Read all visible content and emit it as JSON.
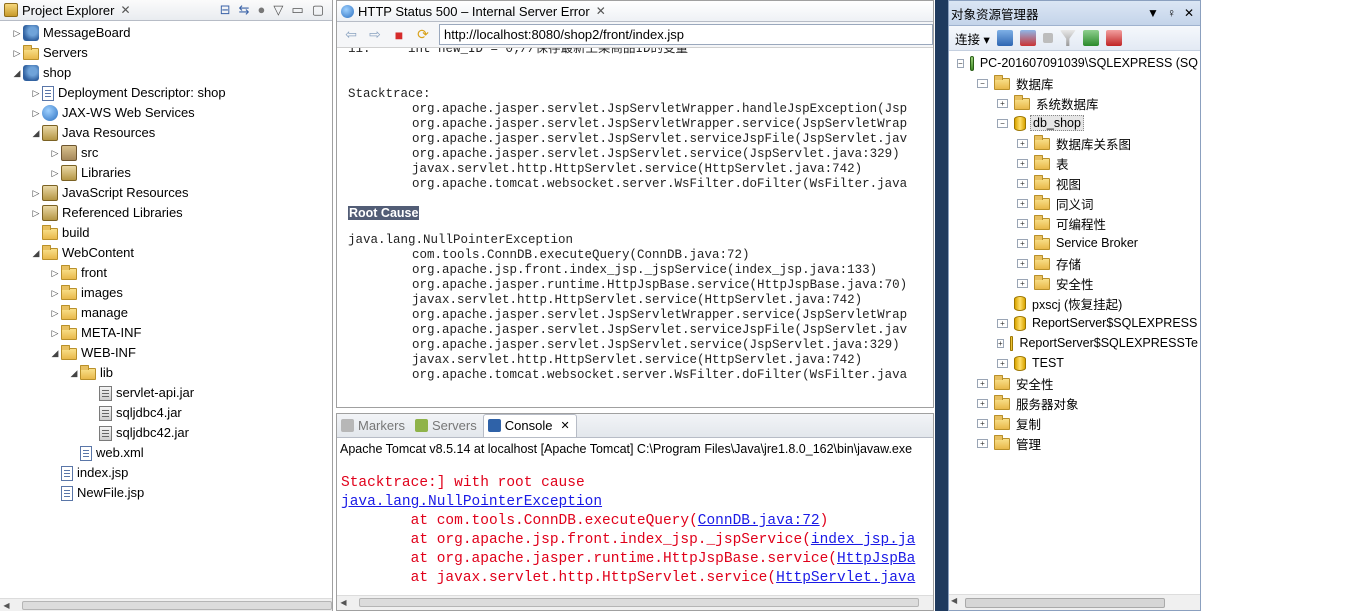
{
  "project_explorer": {
    "title": "Project Explorer",
    "tree": [
      {
        "label": "MessageBoard",
        "depth": 0,
        "twisty": "▷",
        "icon": "project-icon"
      },
      {
        "label": "Servers",
        "depth": 0,
        "twisty": "▷",
        "icon": "folder-icon"
      },
      {
        "label": "shop",
        "depth": 0,
        "twisty": "◢",
        "icon": "project-icon"
      },
      {
        "label": "Deployment Descriptor: shop",
        "depth": 1,
        "twisty": "▷",
        "icon": "descriptor-icon"
      },
      {
        "label": "JAX-WS Web Services",
        "depth": 1,
        "twisty": "▷",
        "icon": "webservice-icon"
      },
      {
        "label": "Java Resources",
        "depth": 1,
        "twisty": "◢",
        "icon": "java-resources-icon"
      },
      {
        "label": "src",
        "depth": 2,
        "twisty": "▷",
        "icon": "package-folder-icon"
      },
      {
        "label": "Libraries",
        "depth": 2,
        "twisty": "▷",
        "icon": "library-icon"
      },
      {
        "label": "JavaScript Resources",
        "depth": 1,
        "twisty": "▷",
        "icon": "js-resources-icon"
      },
      {
        "label": "Referenced Libraries",
        "depth": 1,
        "twisty": "▷",
        "icon": "library-icon"
      },
      {
        "label": "build",
        "depth": 1,
        "twisty": "",
        "icon": "folder-icon"
      },
      {
        "label": "WebContent",
        "depth": 1,
        "twisty": "◢",
        "icon": "folder-icon"
      },
      {
        "label": "front",
        "depth": 2,
        "twisty": "▷",
        "icon": "folder-icon"
      },
      {
        "label": "images",
        "depth": 2,
        "twisty": "▷",
        "icon": "folder-icon"
      },
      {
        "label": "manage",
        "depth": 2,
        "twisty": "▷",
        "icon": "folder-icon"
      },
      {
        "label": "META-INF",
        "depth": 2,
        "twisty": "▷",
        "icon": "folder-icon"
      },
      {
        "label": "WEB-INF",
        "depth": 2,
        "twisty": "◢",
        "icon": "folder-icon"
      },
      {
        "label": "lib",
        "depth": 3,
        "twisty": "◢",
        "icon": "folder-icon"
      },
      {
        "label": "servlet-api.jar",
        "depth": 4,
        "twisty": "",
        "icon": "jar-icon"
      },
      {
        "label": "sqljdbc4.jar",
        "depth": 4,
        "twisty": "",
        "icon": "jar-icon"
      },
      {
        "label": "sqljdbc42.jar",
        "depth": 4,
        "twisty": "",
        "icon": "jar-icon"
      },
      {
        "label": "web.xml",
        "depth": 3,
        "twisty": "",
        "icon": "xml-file-icon"
      },
      {
        "label": "index.jsp",
        "depth": 2,
        "twisty": "",
        "icon": "jsp-file-icon"
      },
      {
        "label": "NewFile.jsp",
        "depth": 2,
        "twisty": "",
        "icon": "jsp-file-icon"
      }
    ]
  },
  "browser": {
    "tab_title": "HTTP Status 500 – Internal Server Error",
    "url": "http://localhost:8080/shop2/front/index.jsp",
    "top_line": "11:     int new_ID = 0;//保存最新上架商品ID的变量",
    "stacktrace_heading": "Stacktrace:",
    "stacktrace": [
      "org.apache.jasper.servlet.JspServletWrapper.handleJspException(Jsp",
      "org.apache.jasper.servlet.JspServletWrapper.service(JspServletWrap",
      "org.apache.jasper.servlet.JspServlet.serviceJspFile(JspServlet.jav",
      "org.apache.jasper.servlet.JspServlet.service(JspServlet.java:329)",
      "javax.servlet.http.HttpServlet.service(HttpServlet.java:742)",
      "org.apache.tomcat.websocket.server.WsFilter.doFilter(WsFilter.java"
    ],
    "root_cause_heading": "Root Cause",
    "exception": "java.lang.NullPointerException",
    "root_cause": [
      "com.tools.ConnDB.executeQuery(ConnDB.java:72)",
      "org.apache.jsp.front.index_jsp._jspService(index_jsp.java:133)",
      "org.apache.jasper.runtime.HttpJspBase.service(HttpJspBase.java:70)",
      "javax.servlet.http.HttpServlet.service(HttpServlet.java:742)",
      "org.apache.jasper.servlet.JspServletWrapper.service(JspServletWrap",
      "org.apache.jasper.servlet.JspServlet.serviceJspFile(JspServlet.jav",
      "org.apache.jasper.servlet.JspServlet.service(JspServlet.java:329)",
      "javax.servlet.http.HttpServlet.service(HttpServlet.java:742)",
      "org.apache.tomcat.websocket.server.WsFilter.doFilter(WsFilter.java"
    ]
  },
  "console": {
    "tabs": [
      {
        "label": "Markers",
        "active": false
      },
      {
        "label": "Servers",
        "active": false
      },
      {
        "label": "Console",
        "active": true
      }
    ],
    "description": "Apache Tomcat v8.5.14 at localhost [Apache Tomcat] C:\\Program Files\\Java\\jre1.8.0_162\\bin\\javaw.exe",
    "line1": "Stacktrace:] with root cause",
    "line2_link": "java.lang.NullPointerException",
    "frames": [
      {
        "prefix": "\tat com.tools.ConnDB.executeQuery(",
        "link": "ConnDB.java:72",
        "suffix": ")"
      },
      {
        "prefix": "\tat org.apache.jsp.front.index_jsp._jspService(",
        "link": "index_jsp.ja",
        "suffix": ""
      },
      {
        "prefix": "\tat org.apache.jasper.runtime.HttpJspBase.service(",
        "link": "HttpJspBa",
        "suffix": ""
      },
      {
        "prefix": "\tat javax.servlet.http.HttpServlet.service(",
        "link": "HttpServlet.java",
        "suffix": ""
      }
    ]
  },
  "object_explorer": {
    "title": "对象资源管理器",
    "connect_label": "连接",
    "tree": [
      {
        "label": "PC-201607091039\\SQLEXPRESS (SQ",
        "depth": 0,
        "pm": "−",
        "icon": "server-icon",
        "selected": false
      },
      {
        "label": "数据库",
        "depth": 1,
        "pm": "−",
        "icon": "folder-icon",
        "selected": false
      },
      {
        "label": "系统数据库",
        "depth": 2,
        "pm": "+",
        "icon": "folder-icon",
        "selected": false
      },
      {
        "label": "db_shop",
        "depth": 2,
        "pm": "−",
        "icon": "database-icon",
        "selected": true
      },
      {
        "label": "数据库关系图",
        "depth": 3,
        "pm": "+",
        "icon": "folder-icon",
        "selected": false
      },
      {
        "label": "表",
        "depth": 3,
        "pm": "+",
        "icon": "folder-icon",
        "selected": false
      },
      {
        "label": "视图",
        "depth": 3,
        "pm": "+",
        "icon": "folder-icon",
        "selected": false
      },
      {
        "label": "同义词",
        "depth": 3,
        "pm": "+",
        "icon": "folder-icon",
        "selected": false
      },
      {
        "label": "可编程性",
        "depth": 3,
        "pm": "+",
        "icon": "folder-icon",
        "selected": false
      },
      {
        "label": "Service Broker",
        "depth": 3,
        "pm": "+",
        "icon": "folder-icon",
        "selected": false
      },
      {
        "label": "存储",
        "depth": 3,
        "pm": "+",
        "icon": "folder-icon",
        "selected": false
      },
      {
        "label": "安全性",
        "depth": 3,
        "pm": "+",
        "icon": "folder-icon",
        "selected": false
      },
      {
        "label": "pxscj (恢复挂起)",
        "depth": 2,
        "pm": "",
        "icon": "database-icon",
        "selected": false
      },
      {
        "label": "ReportServer$SQLEXPRESS",
        "depth": 2,
        "pm": "+",
        "icon": "database-icon",
        "selected": false
      },
      {
        "label": "ReportServer$SQLEXPRESSTe",
        "depth": 2,
        "pm": "+",
        "icon": "database-icon",
        "selected": false
      },
      {
        "label": "TEST",
        "depth": 2,
        "pm": "+",
        "icon": "database-icon",
        "selected": false
      },
      {
        "label": "安全性",
        "depth": 1,
        "pm": "+",
        "icon": "folder-icon",
        "selected": false
      },
      {
        "label": "服务器对象",
        "depth": 1,
        "pm": "+",
        "icon": "folder-icon",
        "selected": false
      },
      {
        "label": "复制",
        "depth": 1,
        "pm": "+",
        "icon": "folder-icon",
        "selected": false
      },
      {
        "label": "管理",
        "depth": 1,
        "pm": "+",
        "icon": "folder-icon",
        "selected": false
      }
    ]
  }
}
